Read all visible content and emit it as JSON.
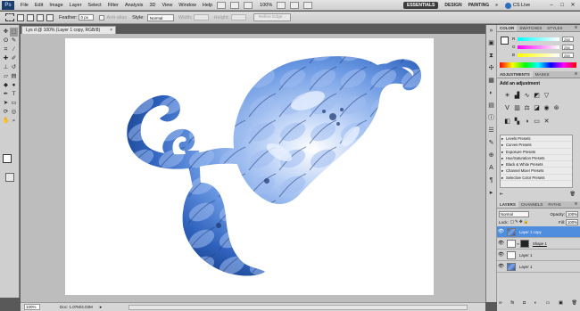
{
  "menubar": {
    "logo": "Ps",
    "items": [
      "File",
      "Edit",
      "Image",
      "Layer",
      "Select",
      "Filter",
      "Analysis",
      "3D",
      "View",
      "Window",
      "Help"
    ],
    "zoom": "100%",
    "workspaces": [
      "ESSENTIALS",
      "DESIGN",
      "PAINTING"
    ],
    "more": "»",
    "cslive": "CS Live"
  },
  "options": {
    "feather_label": "Feather:",
    "feather_value": "0 px",
    "antialias_label": "Anti-alias",
    "style_label": "Style:",
    "style_value": "Normal",
    "width_label": "Width:",
    "height_label": "Height:",
    "refine_label": "Refine Edge..."
  },
  "document": {
    "tab_title": "Lys d @ 100% (Layer 1 copy, RGB/8)",
    "zoom": "100%",
    "doc_size": "Doc: 1.07M/4.03M"
  },
  "color_panel": {
    "tabs": [
      "COLOR",
      "SWATCHES",
      "STYLES"
    ],
    "r_label": "R",
    "g_label": "G",
    "b_label": "B",
    "r": "255",
    "g": "255",
    "b": "255"
  },
  "adjustments_panel": {
    "tabs": [
      "ADJUSTMENTS",
      "MASKS"
    ],
    "title": "Add an adjustment",
    "presets": [
      "Levels Presets",
      "Curves Presets",
      "Exposure Presets",
      "Hue/Saturation Presets",
      "Black & White Presets",
      "Channel Mixer Presets",
      "Selective Color Presets"
    ]
  },
  "layers_panel": {
    "tabs": [
      "LAYERS",
      "CHANNELS",
      "PATHS"
    ],
    "blend_mode": "Normal",
    "opacity_label": "Opacity:",
    "opacity": "100%",
    "lock_label": "Lock:",
    "fill_label": "Fill:",
    "fill": "100%",
    "layers": [
      {
        "name": "Layer 1 copy"
      },
      {
        "name": "Shape 1"
      },
      {
        "name": "Layer 1"
      },
      {
        "name": "Layer 1"
      }
    ]
  },
  "colors": {
    "flower_dark": "#2b5cb3",
    "flower_light": "#a9c4f2",
    "canvas": "#ffffff",
    "active_layer": "#4f8ede"
  }
}
